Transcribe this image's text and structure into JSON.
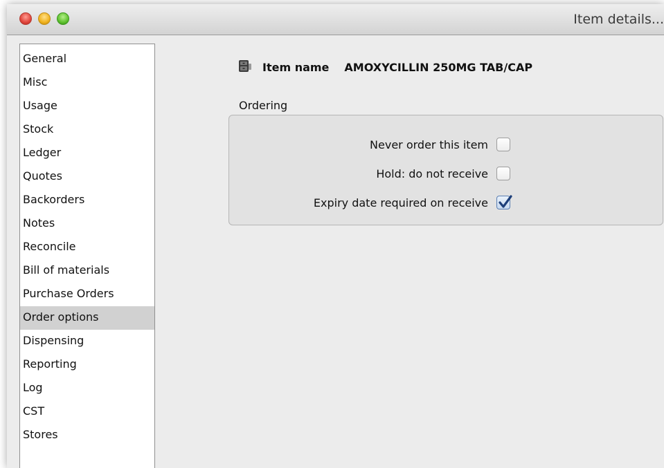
{
  "window": {
    "title": "Item details..."
  },
  "sidebar": {
    "items": [
      {
        "label": "General"
      },
      {
        "label": "Misc"
      },
      {
        "label": "Usage"
      },
      {
        "label": "Stock"
      },
      {
        "label": "Ledger"
      },
      {
        "label": "Quotes"
      },
      {
        "label": "Backorders"
      },
      {
        "label": "Notes"
      },
      {
        "label": "Reconcile"
      },
      {
        "label": "Bill of materials"
      },
      {
        "label": "Purchase Orders"
      },
      {
        "label": "Order options",
        "selected": true
      },
      {
        "label": "Dispensing"
      },
      {
        "label": "Reporting"
      },
      {
        "label": "Log"
      },
      {
        "label": "CST"
      },
      {
        "label": "Stores"
      }
    ]
  },
  "header": {
    "icon": "drawer-icon",
    "item_name_label": "Item name",
    "item_name_value": "AMOXYCILLIN 250MG TAB/CAP"
  },
  "ordering": {
    "title": "Ordering",
    "options": [
      {
        "label": "Never order this item",
        "checked": false
      },
      {
        "label": "Hold: do not receive",
        "checked": false
      },
      {
        "label": "Expiry date required on receive",
        "checked": true
      }
    ]
  },
  "colors": {
    "selected_row": "#d1d1d1",
    "panel_background": "#e2e2e2",
    "checkmark": "#1d3f7a"
  }
}
